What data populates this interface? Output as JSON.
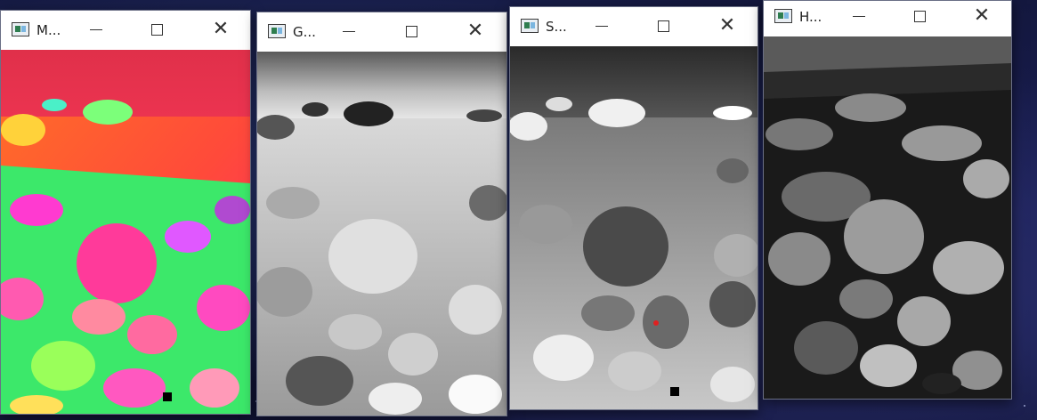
{
  "desktop": {
    "theme": "space-wallpaper"
  },
  "windows": [
    {
      "title": "M...",
      "image_kind": "hsv-false-color beach photo"
    },
    {
      "title": "G...",
      "image_kind": "grayscale beach photo"
    },
    {
      "title": "S...",
      "image_kind": "saturation channel beach photo"
    },
    {
      "title": "H...",
      "image_kind": "hue channel beach photo"
    }
  ],
  "icons": {
    "app": "window-app-icon",
    "minimize": "minimize-icon",
    "maximize": "maximize-icon",
    "close": "close-icon"
  },
  "colors": {
    "titlebar": "#ffffff",
    "border": "#6a6f86"
  }
}
